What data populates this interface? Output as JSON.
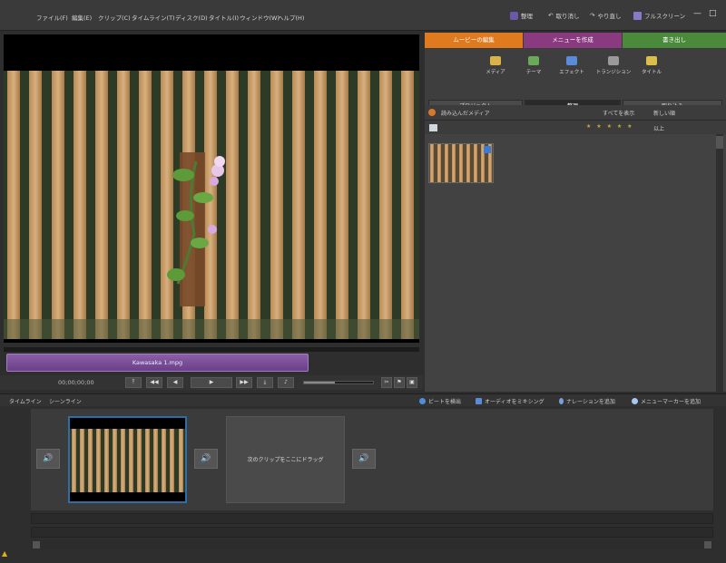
{
  "menubar": {
    "items": [
      "ファイル(F)",
      "編集(E)",
      "クリップ(C)",
      "タイムライン(T)",
      "ディスク(D)",
      "タイトル(I)",
      "ウィンドウ(W)",
      "ヘルプ(H)"
    ],
    "undo_label": "取り消し",
    "redo_label": "やり直し",
    "organizer_label": "整理",
    "fullscreen_label": "フルスクリーン",
    "win_controls": [
      "—",
      "□"
    ]
  },
  "monitor": {
    "clip_name": "Kawasaka 1.mpg",
    "timecode": "00;00;00;00",
    "transport_buttons": [
      "⤒",
      "◀◀",
      "◀",
      "▶",
      "▶▶",
      "⤓",
      "♪"
    ],
    "volume_level": 0.45
  },
  "right_panel": {
    "main_tabs": [
      {
        "label": "ムービーの編集",
        "color": "#e07a1e"
      },
      {
        "label": "メニューを作成",
        "color": "#8a3a7e"
      },
      {
        "label": "書き出し",
        "color": "#4a8a3a"
      }
    ],
    "sub_icons": [
      {
        "label": "メディア",
        "icon": "media-icon",
        "color": "#d9b24a"
      },
      {
        "label": "テーマ",
        "icon": "themes-icon",
        "color": "#6aa85a"
      },
      {
        "label": "エフェクト",
        "icon": "effects-icon",
        "color": "#5a8ad8"
      },
      {
        "label": "トランジション",
        "icon": "transitions-icon",
        "color": "#9a9a9a"
      },
      {
        "label": "タイトル",
        "icon": "titles-icon",
        "color": "#d8c04a"
      }
    ],
    "segments": [
      "プロジェクト",
      "整理",
      "取り込み"
    ],
    "list_header": {
      "label": "読み込んだメディア",
      "show_all": "すべてを表示",
      "sort": "新しい順"
    },
    "rating_row": {
      "stars": "★ ★ ★ ★ ★",
      "filter": "以上"
    },
    "thumb_badge": "clip-badge-icon"
  },
  "timeline": {
    "tabs": [
      "タイムライン",
      "シーンライン"
    ],
    "actions": [
      {
        "label": "ビートを検出",
        "icon": "beat-icon"
      },
      {
        "label": "オーディオをミキシング",
        "icon": "audio-mix-icon"
      },
      {
        "label": "ナレーションを追加",
        "icon": "mic-icon"
      },
      {
        "label": "メニューマーカーを追加",
        "icon": "marker-icon"
      }
    ],
    "empty_slot_label": "次のクリップをここにドラッグ",
    "transition_glyph": "🔊"
  }
}
